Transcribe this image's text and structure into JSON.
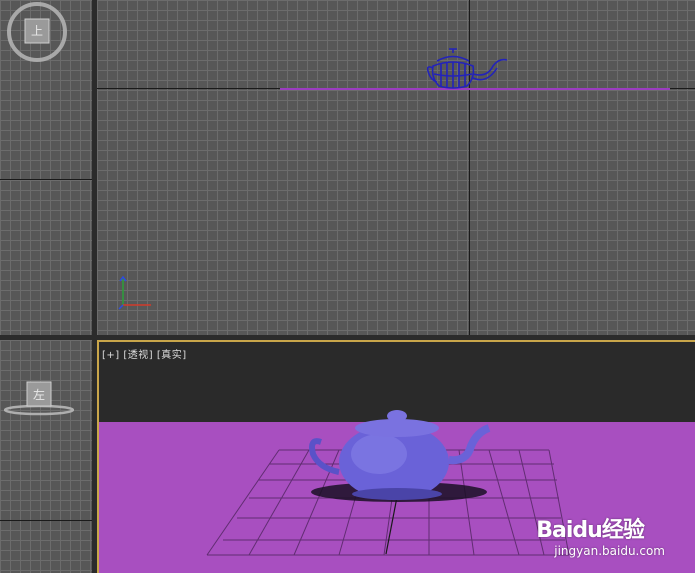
{
  "viewports": {
    "top_left": {
      "cube_label": "上"
    },
    "top_main": {},
    "bottom_left": {
      "cube_label": "左"
    },
    "perspective": {
      "label_plus": "[+]",
      "label_view": "[透视]",
      "label_shading": "[真实]",
      "background_color": "#a84fc0"
    }
  },
  "object": {
    "name": "teapot",
    "wire_color": "#2222bb",
    "shaded_color": "#6a62d8"
  },
  "watermark": {
    "brand": "Baidu经验",
    "url": "jingyan.baidu.com"
  }
}
